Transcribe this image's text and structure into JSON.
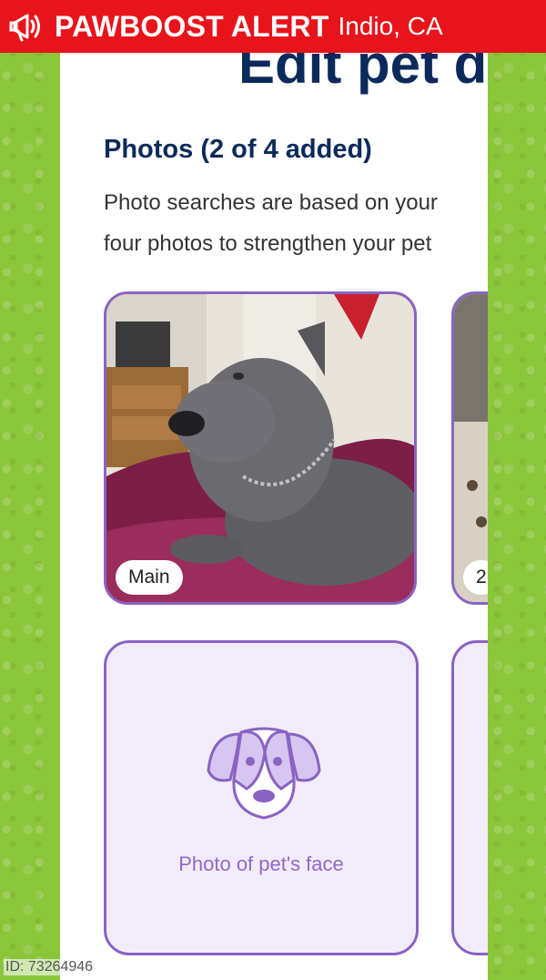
{
  "alert": {
    "title": "PAWBOOST ALERT",
    "location": "Indio, CA",
    "icon": "megaphone-icon"
  },
  "page": {
    "heading": "Edit pet d"
  },
  "photos": {
    "heading": "Photos (2 of 4 added)",
    "description_line1": "Photo searches are based on your",
    "description_line2": "four photos to strengthen your pet",
    "tiles": [
      {
        "badge": "Main"
      },
      {
        "badge": "2"
      }
    ],
    "placeholder_caption": "Photo of pet's face"
  },
  "footer": {
    "id": "ID: 73264946"
  },
  "colors": {
    "alert_red": "#e8141b",
    "background_green": "#8bc53a",
    "heading_navy": "#0b2a5b",
    "accent_purple": "#8a63c4"
  }
}
